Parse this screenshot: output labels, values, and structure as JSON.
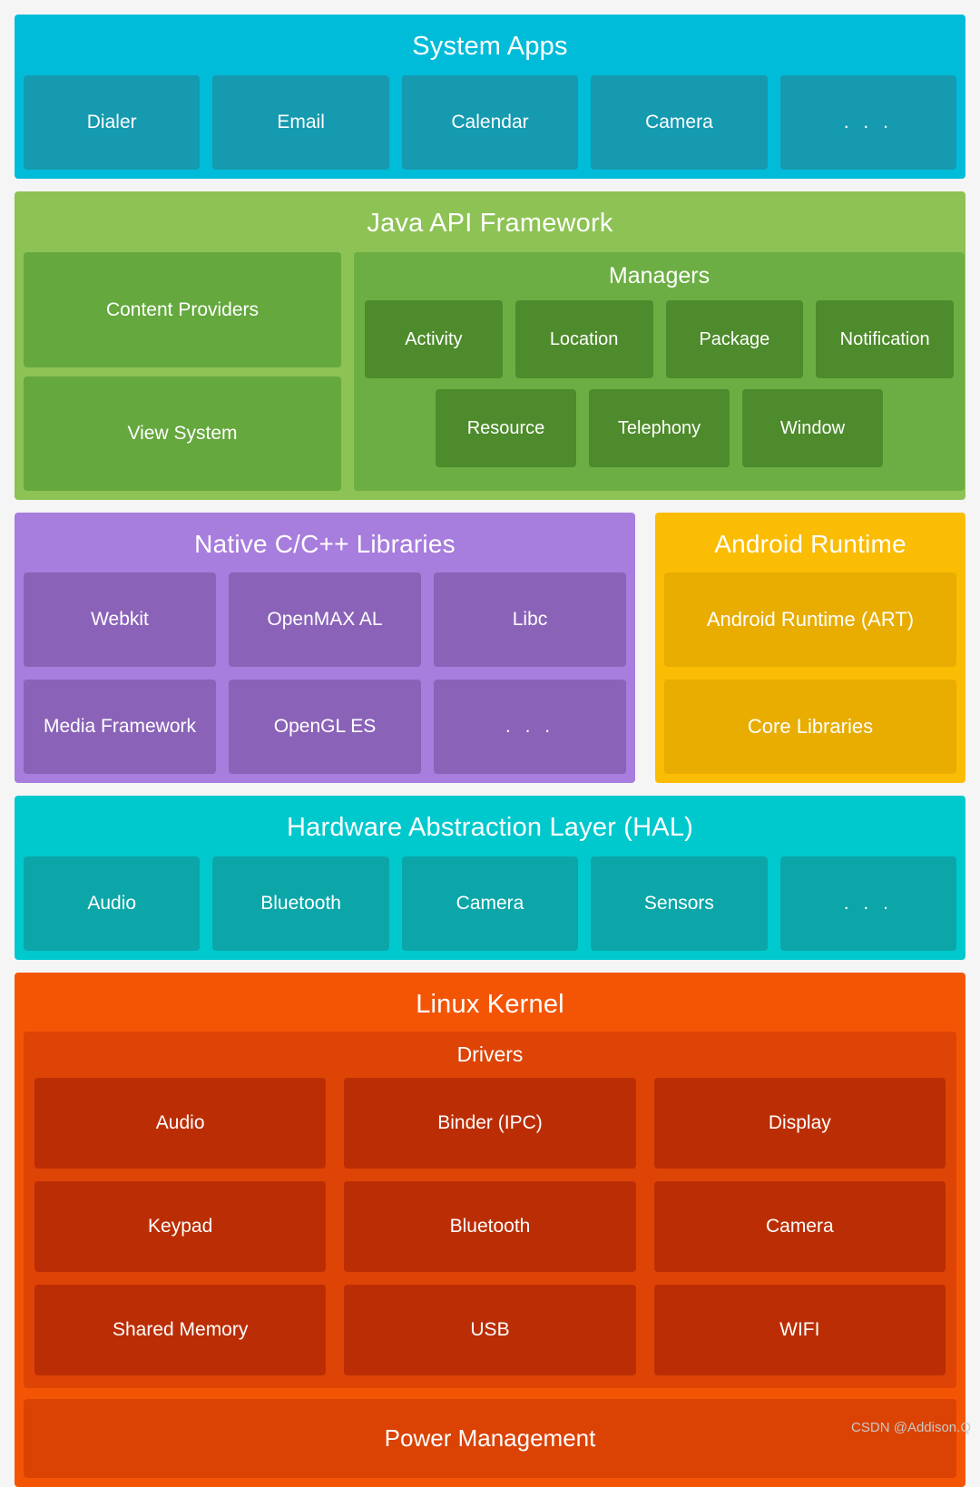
{
  "layers": [
    {
      "id": "system-apps",
      "title": "System Apps",
      "color": "#00bcd9",
      "tile_color": "#159ab0",
      "tiles": [
        "Dialer",
        "Email",
        "Calendar",
        "Camera",
        ". . ."
      ]
    },
    {
      "id": "java-api-framework",
      "title": "Java API Framework",
      "color": "#8dc254",
      "left_tiles": [
        "Content Providers",
        "View System"
      ],
      "managers": {
        "title": "Managers",
        "color": "#6cae43",
        "tile_color": "#4e8b2c",
        "row1": [
          "Activity",
          "Location",
          "Package",
          "Notification"
        ],
        "row2": [
          "Resource",
          "Telephony",
          "Window"
        ]
      }
    },
    {
      "id": "native-c-cpp-libraries",
      "title": "Native C/C++ Libraries",
      "color": "#a77ddd",
      "tile_color": "#8a63b8",
      "row1": [
        "Webkit",
        "OpenMAX AL",
        "Libc"
      ],
      "row2": [
        "Media Framework",
        "OpenGL ES",
        ". . ."
      ]
    },
    {
      "id": "android-runtime",
      "title": "Android Runtime",
      "color": "#fbbc04",
      "tile_color": "#e8ad00",
      "tiles": [
        "Android Runtime (ART)",
        "Core Libraries"
      ]
    },
    {
      "id": "hardware-abstraction-layer",
      "title": "Hardware Abstraction Layer (HAL)",
      "color": "#00c9ce",
      "tile_color": "#0ca6a9",
      "tiles": [
        "Audio",
        "Bluetooth",
        "Camera",
        "Sensors",
        ". . ."
      ]
    },
    {
      "id": "linux-kernel",
      "title": "Linux Kernel",
      "color": "#f45505",
      "drivers": {
        "title": "Drivers",
        "color": "#dd4405",
        "tile_color": "#bb2e05",
        "row1": [
          "Audio",
          "Binder (IPC)",
          "Display"
        ],
        "row2": [
          "Keypad",
          "Bluetooth",
          "Camera"
        ],
        "row3": [
          "Shared Memory",
          "USB",
          "WIFI"
        ]
      },
      "power_management": "Power Management"
    }
  ],
  "watermark": "CSDN @Addison.Q"
}
